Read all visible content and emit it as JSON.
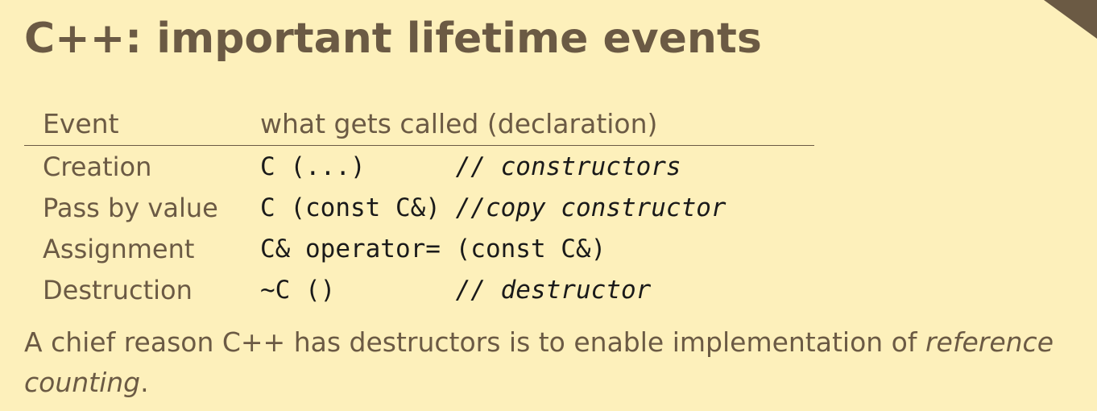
{
  "slide": {
    "title": "C++: important lifetime events",
    "table": {
      "headers": {
        "event": "Event",
        "call": "what gets called (declaration)"
      },
      "rows": [
        {
          "event": "Creation",
          "code": "C (...)      ",
          "comment": "// constructors"
        },
        {
          "event": "Pass by value",
          "code": "C (const C&) ",
          "comment": "//copy constructor"
        },
        {
          "event": "Assignment",
          "code": "C& operator= (const C&)",
          "comment": ""
        },
        {
          "event": "Destruction",
          "code": "~C ()        ",
          "comment": "// destructor"
        }
      ]
    },
    "note": {
      "text_before": "A chief reason C++ has destructors is to enable implementation of ",
      "emphasis": "reference counting",
      "text_after": "."
    }
  },
  "colors": {
    "background": "#fdf0bb",
    "text": "#6b5a44",
    "code": "#1a1a1a"
  }
}
